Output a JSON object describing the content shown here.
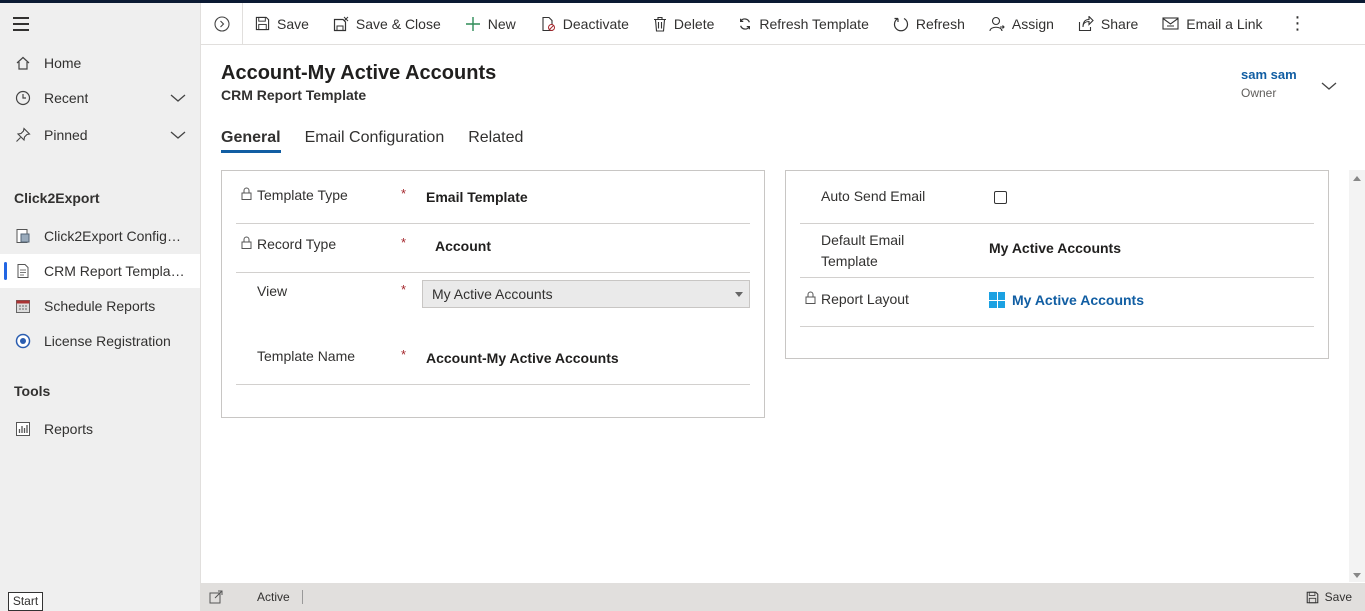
{
  "sidebar": {
    "items_top": [
      {
        "label": "Home",
        "icon": "home-icon"
      },
      {
        "label": "Recent",
        "icon": "clock-icon"
      },
      {
        "label": "Pinned",
        "icon": "pin-icon"
      }
    ],
    "section1_title": "Click2Export",
    "section1_items": [
      {
        "label": "Click2Export Configu...",
        "icon": "config-icon"
      },
      {
        "label": "CRM Report Templates",
        "icon": "document-icon"
      },
      {
        "label": "Schedule Reports",
        "icon": "calendar-icon"
      },
      {
        "label": "License Registration",
        "icon": "license-icon"
      }
    ],
    "section2_title": "Tools",
    "section2_items": [
      {
        "label": "Reports",
        "icon": "reports-icon"
      }
    ],
    "start_label": "Start"
  },
  "commands": {
    "save": "Save",
    "save_close": "Save & Close",
    "new": "New",
    "deactivate": "Deactivate",
    "delete": "Delete",
    "refresh_template": "Refresh Template",
    "refresh": "Refresh",
    "assign": "Assign",
    "share": "Share",
    "email_link": "Email a Link",
    "more": "⋮"
  },
  "header": {
    "title": "Account-My Active Accounts",
    "subtitle": "CRM Report Template",
    "owner_name": "sam sam",
    "owner_label": "Owner"
  },
  "tabs": [
    "General",
    "Email Configuration",
    "Related"
  ],
  "left_section": {
    "template_type_label": "Template Type",
    "template_type_value": "Email Template",
    "record_type_label": "Record Type",
    "record_type_value": "Account",
    "view_label": "View",
    "view_value": "My Active Accounts",
    "template_name_label": "Template Name",
    "template_name_value": "Account-My Active Accounts",
    "required_mark": "*"
  },
  "right_section": {
    "auto_send_label": "Auto Send Email",
    "auto_send_checked": false,
    "default_email_label_1": "Default Email",
    "default_email_label_2": "Template",
    "default_email_value": "My Active Accounts",
    "report_layout_label": "Report Layout",
    "report_layout_value": "My Active Accounts"
  },
  "footer": {
    "status": "Active",
    "save_label": "Save"
  },
  "colors": {
    "accent": "#115ea3",
    "required": "#a4262c",
    "sidebar_bg": "#efefef",
    "active_marker": "#2266e3"
  }
}
